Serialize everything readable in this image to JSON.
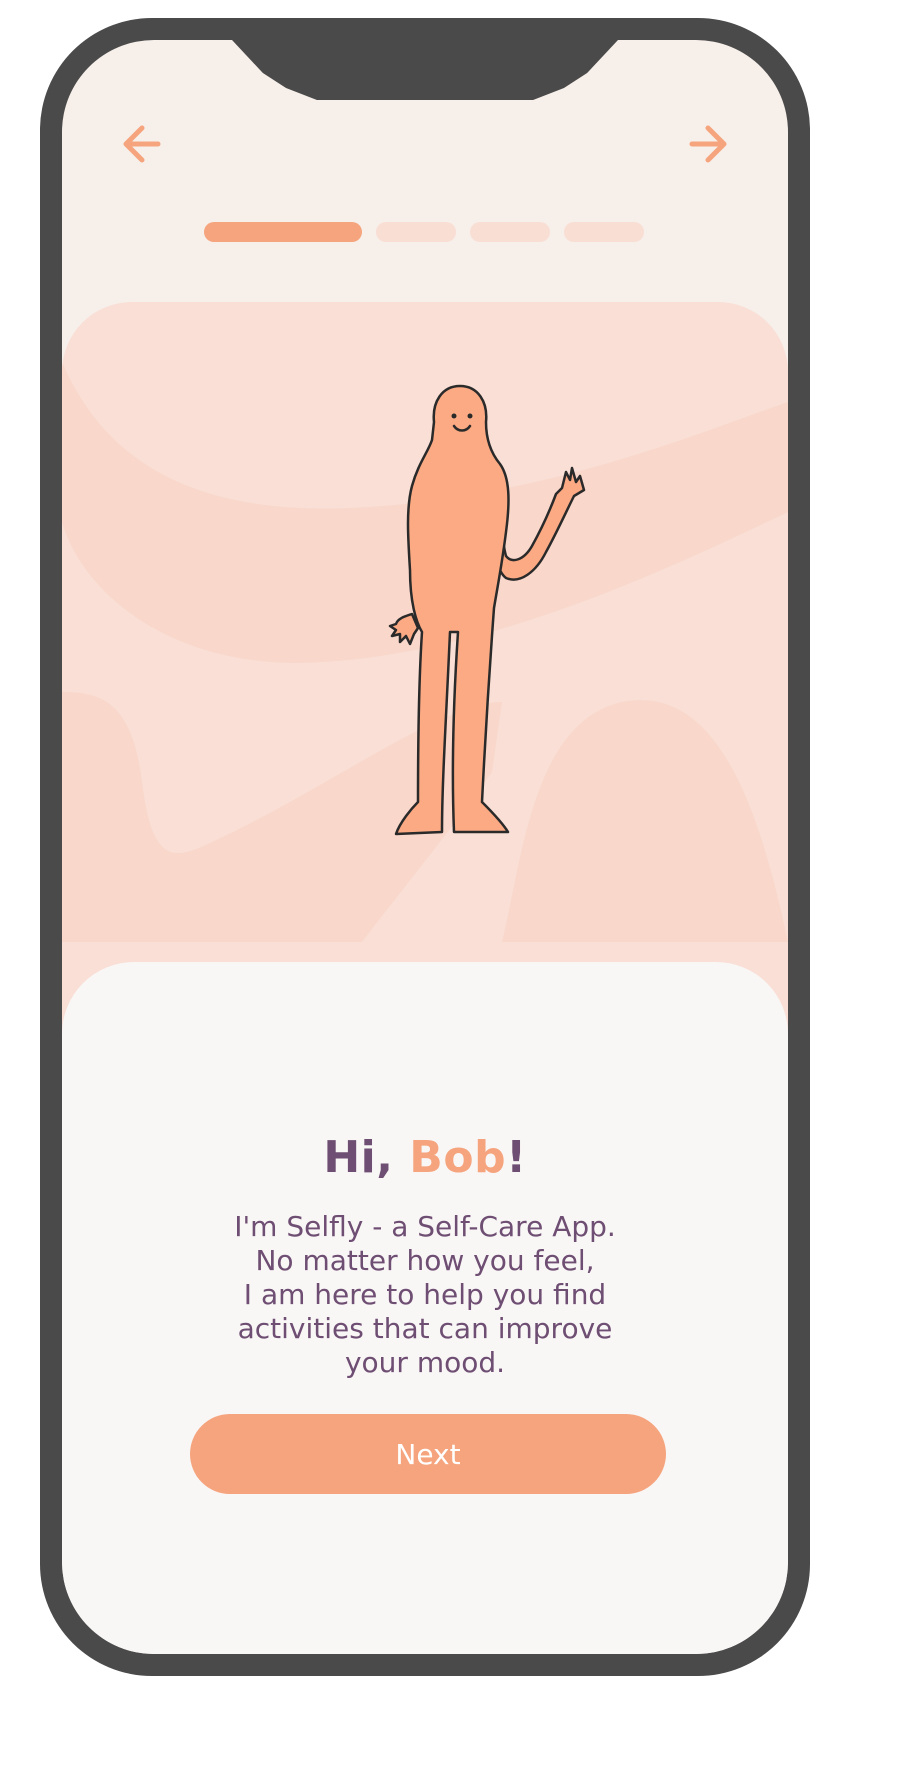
{
  "app": {
    "name": "Selfly"
  },
  "navigation": {
    "back_icon": "arrow-left-icon",
    "forward_icon": "arrow-right-icon"
  },
  "progress": {
    "current_step": 1,
    "total_steps": 4
  },
  "illustration": {
    "subject": "waving-person-illustration"
  },
  "onboarding": {
    "greeting_prefix": "Hi, ",
    "user_name": "Bob",
    "greeting_suffix": "!",
    "message_lines": [
      "I'm Selfly - a Self-Care App.",
      "No matter how you feel,",
      "I am here to help you find",
      "activities that can improve",
      "your mood."
    ],
    "next_label": "Next"
  },
  "colors": {
    "accent": "#f5a47d",
    "text": "#6e4e72",
    "background": "#f7efea",
    "hero_background": "#f9dfd5",
    "frame": "#4a4a4a"
  }
}
